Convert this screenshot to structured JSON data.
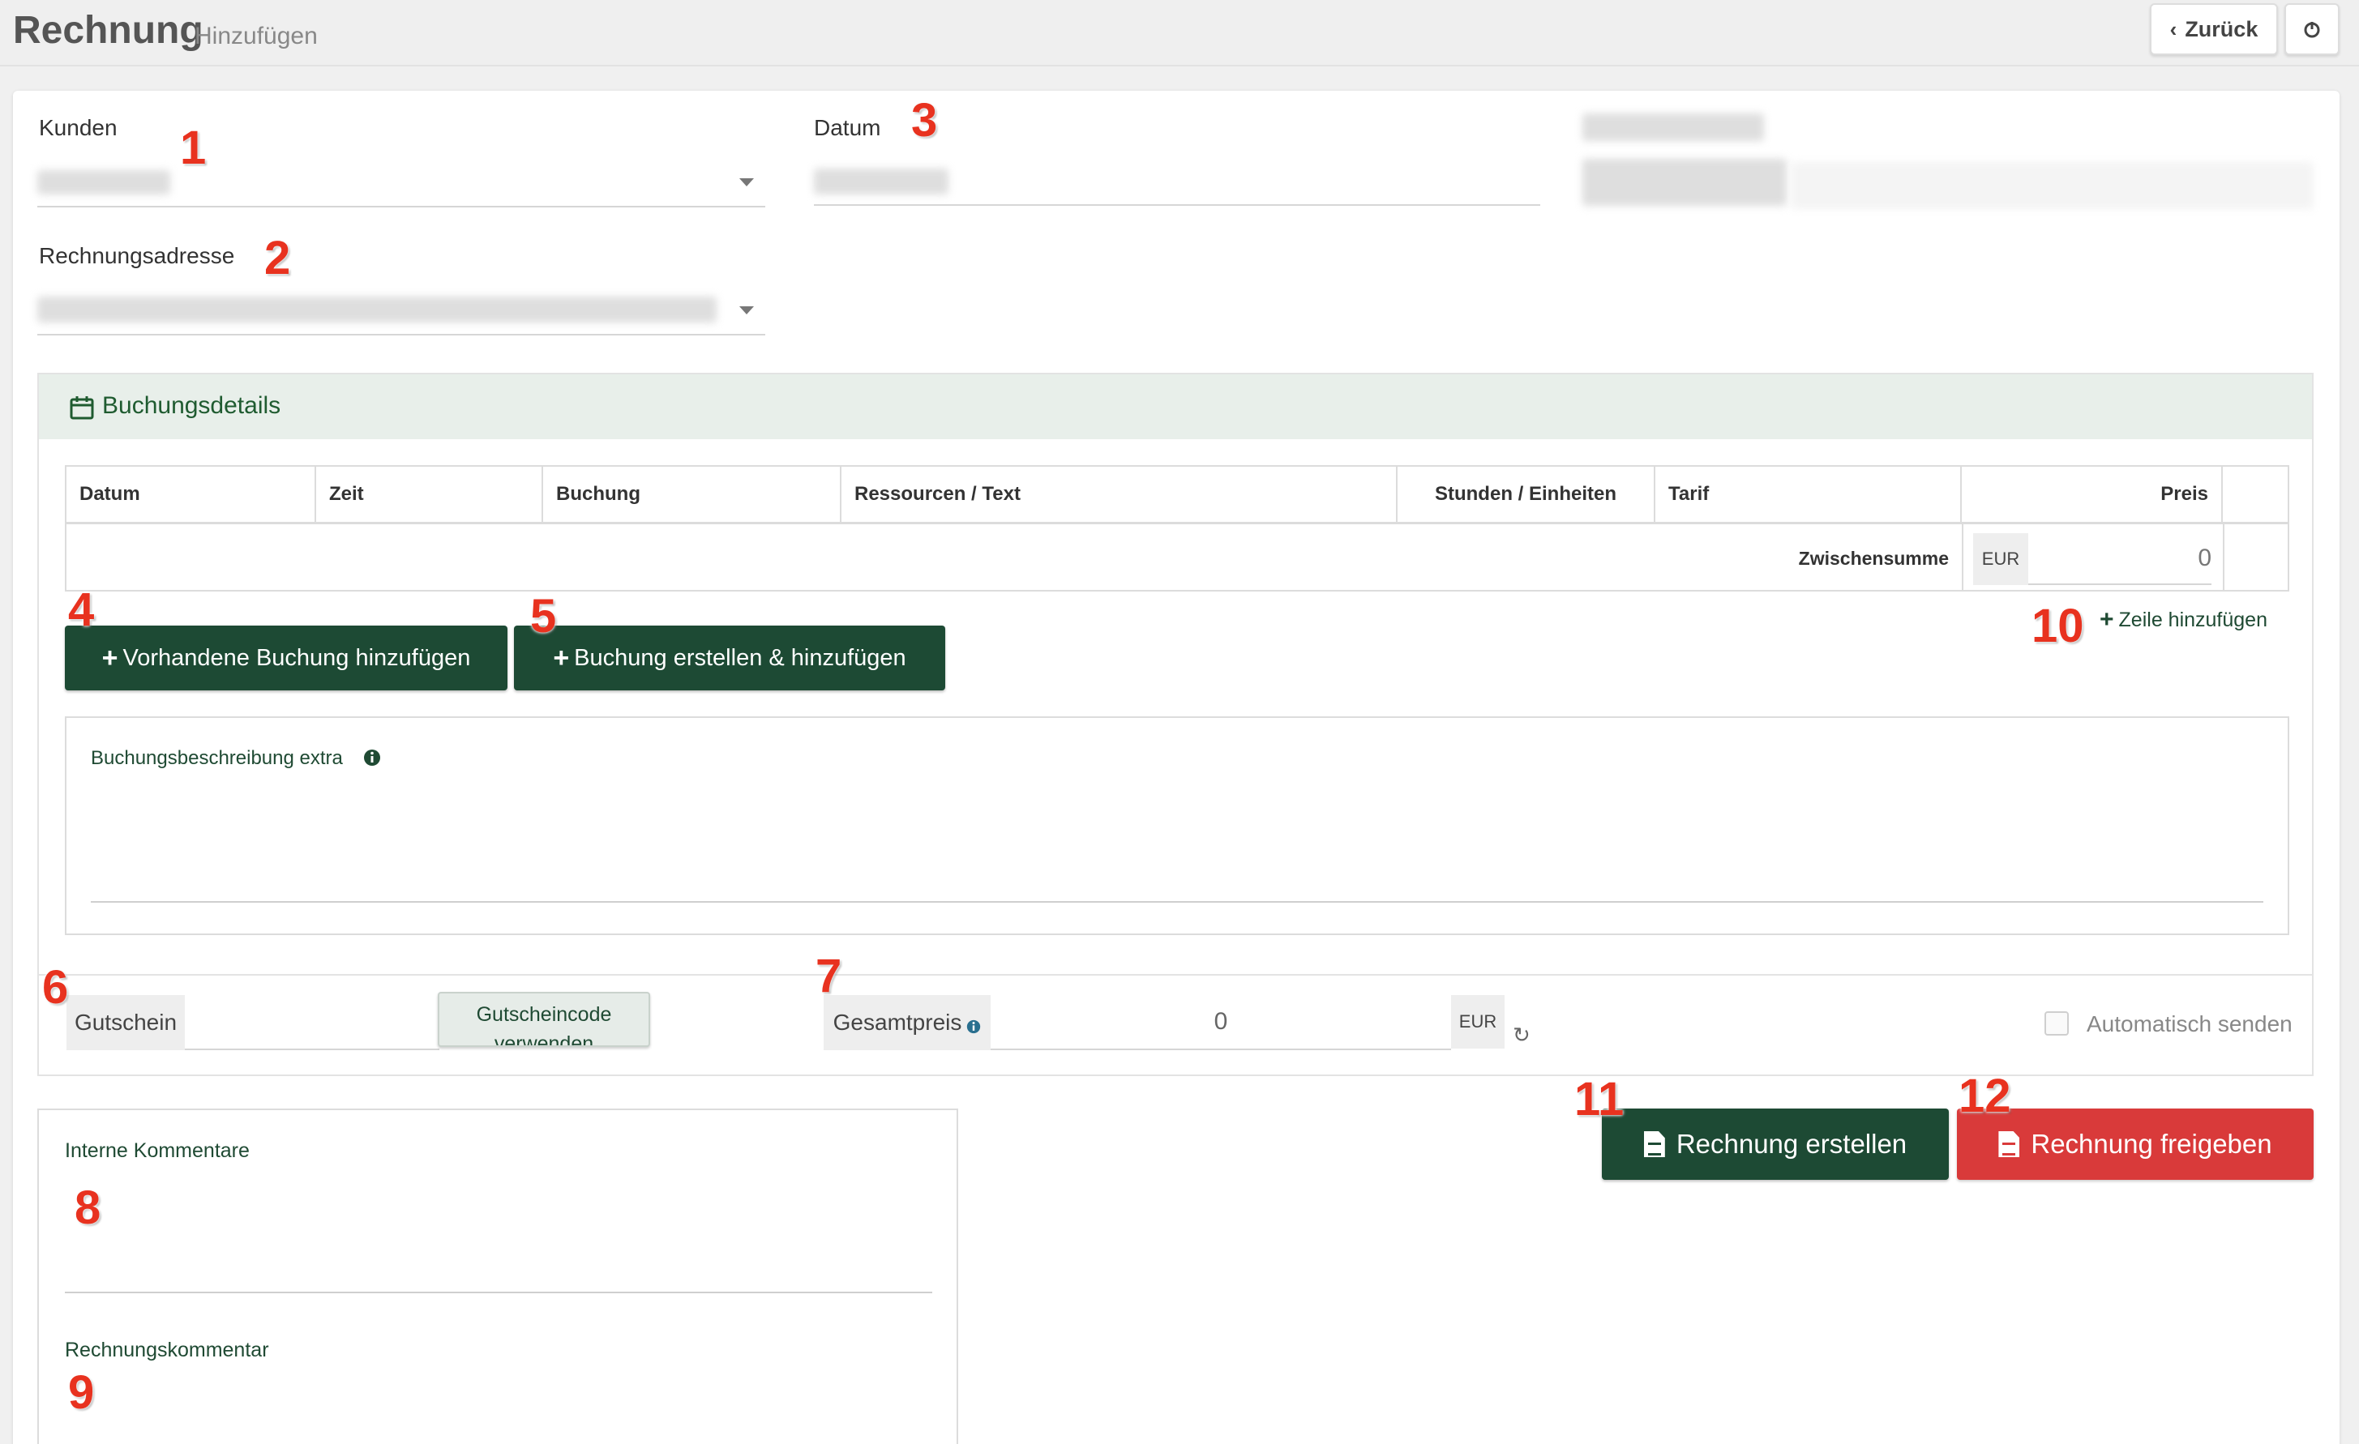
{
  "header": {
    "title": "Rechnung",
    "subtitle": "Hinzufügen",
    "back_label": "Zurück",
    "back_icon": "chevron-left-icon",
    "power_icon": "power-icon"
  },
  "form": {
    "customer_label": "Kunden",
    "date_label": "Datum",
    "billing_address_label": "Rechnungsadresse"
  },
  "booking": {
    "title": "Buchungsdetails",
    "icon": "calendar-icon",
    "columns": [
      "Datum",
      "Zeit",
      "Buchung",
      "Ressourcen / Text",
      "Stunden / Einheiten",
      "Tarif",
      "Preis"
    ],
    "subtotal_label": "Zwischensumme",
    "subtotal_currency": "EUR",
    "subtotal_value": "0",
    "add_line_label": "Zeile hinzufügen",
    "add_existing_label": "Vorhandene Buchung hinzufügen",
    "create_add_label": "Buchung erstellen & hinzufügen",
    "extra_description_label": "Buchungsbeschreibung extra"
  },
  "footer": {
    "voucher_label": "Gutschein",
    "voucher_button_line1": "Gutscheincode",
    "voucher_button_line2": "verwenden",
    "total_label": "Gesamtpreis",
    "total_value": "0",
    "total_currency": "EUR",
    "auto_send_label": "Automatisch senden"
  },
  "comments": {
    "internal_label": "Interne Kommentare",
    "invoice_comment_label": "Rechnungskommentar"
  },
  "actions": {
    "create_invoice_label": "Rechnung erstellen",
    "release_invoice_label": "Rechnung freigeben"
  },
  "annotations": [
    "1",
    "2",
    "3",
    "4",
    "5",
    "6",
    "7",
    "8",
    "9",
    "10",
    "11",
    "12"
  ],
  "colors": {
    "primary_green": "#1d4a34",
    "danger_red": "#d93a3a",
    "panel_header": "#e8efea",
    "annotation_red": "#e8321f"
  }
}
